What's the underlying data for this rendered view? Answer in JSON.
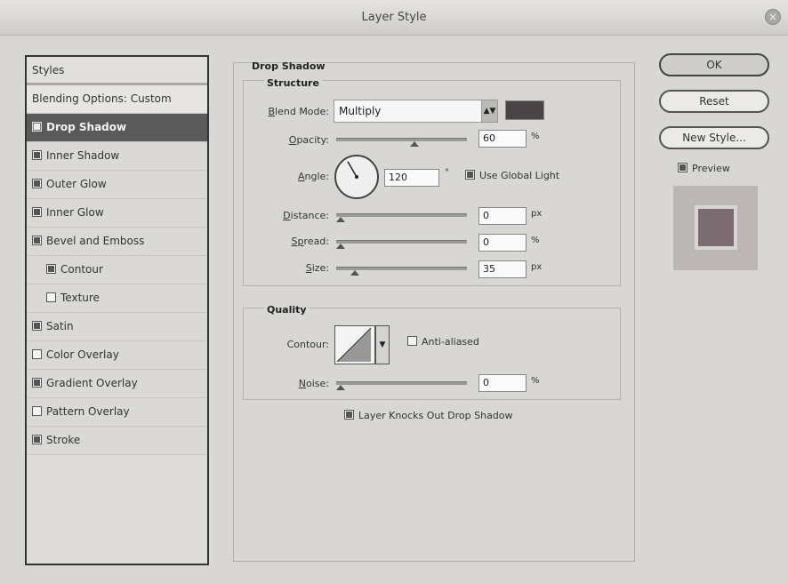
{
  "window": {
    "title": "Layer Style",
    "close_glyph": "×"
  },
  "styles_list": {
    "items": [
      {
        "label": "Styles",
        "checkbox": false,
        "checked": false,
        "kind": "head"
      },
      {
        "label": "Blending Options: Custom",
        "checkbox": false,
        "checked": false,
        "kind": "blend"
      },
      {
        "label": "Drop Shadow",
        "checkbox": true,
        "checked": true,
        "kind": "selected"
      },
      {
        "label": "Inner Shadow",
        "checkbox": true,
        "checked": true,
        "kind": "normal"
      },
      {
        "label": "Outer Glow",
        "checkbox": true,
        "checked": true,
        "kind": "normal"
      },
      {
        "label": "Inner Glow",
        "checkbox": true,
        "checked": true,
        "kind": "normal"
      },
      {
        "label": "Bevel and Emboss",
        "checkbox": true,
        "checked": true,
        "kind": "normal"
      },
      {
        "label": "Contour",
        "checkbox": true,
        "checked": true,
        "kind": "sub"
      },
      {
        "label": "Texture",
        "checkbox": true,
        "checked": false,
        "kind": "sub"
      },
      {
        "label": "Satin",
        "checkbox": true,
        "checked": true,
        "kind": "normal"
      },
      {
        "label": "Color Overlay",
        "checkbox": true,
        "checked": false,
        "kind": "normal"
      },
      {
        "label": "Gradient Overlay",
        "checkbox": true,
        "checked": true,
        "kind": "normal"
      },
      {
        "label": "Pattern Overlay",
        "checkbox": true,
        "checked": false,
        "kind": "normal"
      },
      {
        "label": "Stroke",
        "checkbox": true,
        "checked": true,
        "kind": "normal"
      }
    ]
  },
  "drop_shadow": {
    "title": "Drop Shadow",
    "structure": {
      "title": "Structure",
      "blend_mode_label_prefix": "B",
      "blend_mode_label_rest": "lend Mode:",
      "blend_mode_value": "Multiply",
      "shadow_color": "#4a4446",
      "opacity_label_prefix": "O",
      "opacity_label_rest": "pacity:",
      "opacity_value": "60",
      "opacity_unit": "%",
      "opacity_fraction": 0.6,
      "angle_label_prefix": "A",
      "angle_label_rest": "ngle:",
      "angle_value": "120",
      "angle_unit": "°",
      "angle_degrees": 120,
      "use_global_light_label": "Use Global Light",
      "use_global_light_checked": true,
      "distance_label_prefix": "D",
      "distance_label_rest": "istance:",
      "distance_value": "0",
      "distance_unit": "px",
      "distance_fraction": 0.0,
      "spread_label_prefix": "Sp",
      "spread_label_rest": "read:",
      "spread_value": "0",
      "spread_unit": "%",
      "spread_fraction": 0.0,
      "size_label_prefix": "S",
      "size_label_rest": "ize:",
      "size_value": "35",
      "size_unit": "px",
      "size_fraction": 0.14
    },
    "quality": {
      "title": "Quality",
      "contour_label": "Contour:",
      "anti_aliased_label": "Anti-aliased",
      "anti_aliased_checked": false,
      "noise_label_prefix": "N",
      "noise_label_rest": "oise:",
      "noise_value": "0",
      "noise_unit": "%",
      "noise_fraction": 0.0
    },
    "knocks_out_label": "Layer Knocks Out Drop Shadow",
    "knocks_out_checked": true
  },
  "buttons": {
    "ok": "OK",
    "reset": "Reset",
    "new_style": "New Style...",
    "preview_label": "Preview",
    "preview_checked": true
  }
}
